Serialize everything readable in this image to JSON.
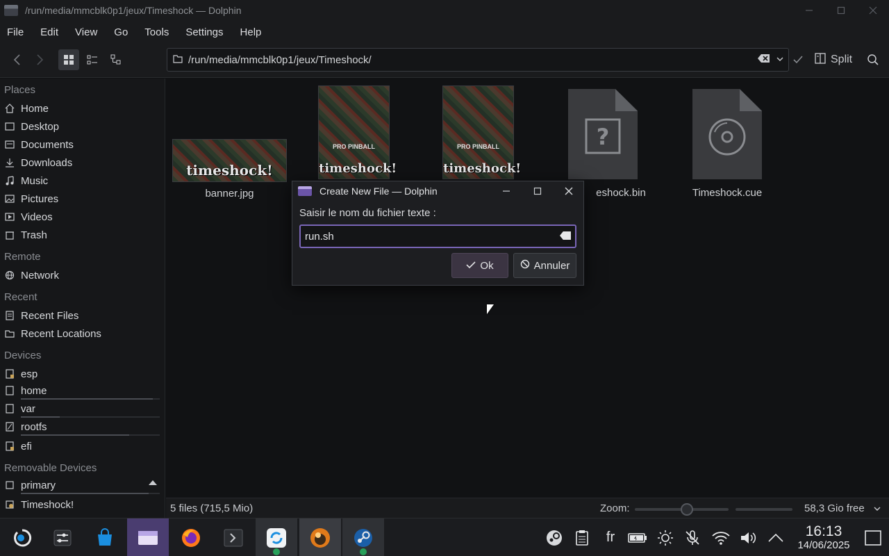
{
  "window": {
    "title": "/run/media/mmcblk0p1/jeux/Timeshock — Dolphin"
  },
  "menubar": [
    "File",
    "Edit",
    "View",
    "Go",
    "Tools",
    "Settings",
    "Help"
  ],
  "toolbar": {
    "path": "/run/media/mmcblk0p1/jeux/Timeshock/",
    "split_label": "Split"
  },
  "sidebar": {
    "places_heading": "Places",
    "places": [
      "Home",
      "Desktop",
      "Documents",
      "Downloads",
      "Music",
      "Pictures",
      "Videos",
      "Trash"
    ],
    "remote_heading": "Remote",
    "remote": [
      "Network"
    ],
    "recent_heading": "Recent",
    "recent": [
      "Recent Files",
      "Recent Locations"
    ],
    "devices_heading": "Devices",
    "devices": [
      "esp",
      "home",
      "var",
      "rootfs",
      "efi"
    ],
    "removable_heading": "Removable Devices",
    "removable": [
      "primary",
      "Timeshock!"
    ]
  },
  "files": [
    {
      "name": "banner.jpg",
      "thumb_text": "timeshock!"
    },
    {
      "name": "",
      "thumb_text": "timeshock!",
      "thumb_subtitle": "PRO PINBALL"
    },
    {
      "name": "",
      "thumb_text": "timeshock!",
      "thumb_subtitle": "PRO PINBALL"
    },
    {
      "name": "eshock.bin"
    },
    {
      "name": "Timeshock.cue"
    }
  ],
  "statusbar": {
    "summary": "5 files (715,5 Mio)",
    "zoom_label": "Zoom:",
    "free_space": "58,3 Gio free"
  },
  "dialog": {
    "title": "Create New File — Dolphin",
    "prompt": "Saisir le nom du fichier texte :",
    "input_value": "run.sh",
    "ok_label": "Ok",
    "cancel_label": "Annuler"
  },
  "tray": {
    "language": "fr",
    "time": "16:13",
    "date": "14/06/2025"
  },
  "colors": {
    "accent": "#7a66b8",
    "background": "#111214",
    "panel": "#1a1b1d"
  }
}
